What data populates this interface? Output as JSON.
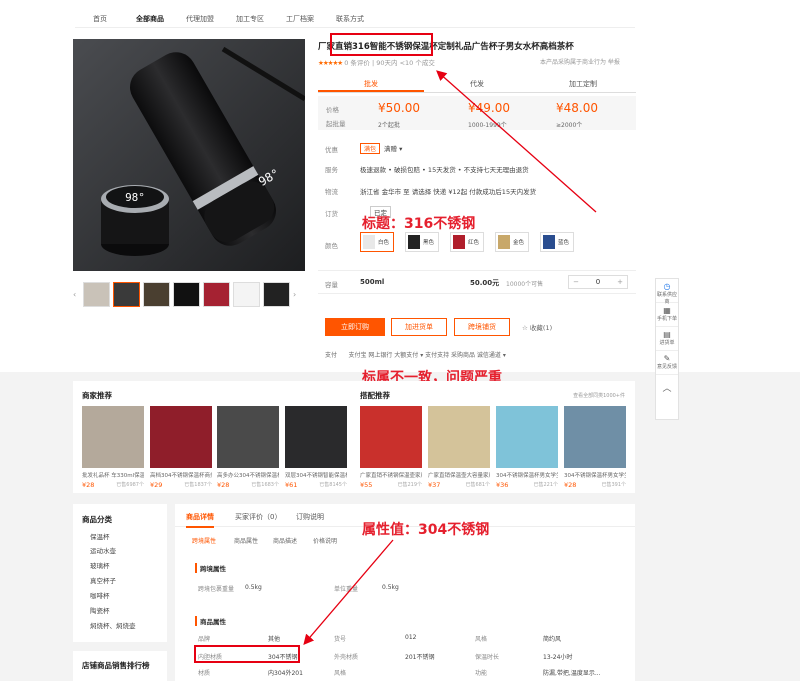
{
  "nav": [
    "首页",
    "全部商品",
    "代理加盟",
    "加工专区",
    "工厂档案",
    "联系方式"
  ],
  "product": {
    "title": "厂家直销316智能不锈钢保温杯定制礼品广告杯子男女水杯高档茶杯",
    "rating_text": "0 条评价 | 90天内 <10 个成交",
    "sub_right": "本产品采购属于商业行为  举报",
    "tabs": [
      "批发",
      "代发",
      "加工定制"
    ],
    "price_label": "价格",
    "qty_label": "起批量",
    "prices": [
      "¥50.00",
      "¥49.00",
      "¥48.00"
    ],
    "ranges": [
      "2个起批",
      "1000-1999个",
      "≥2000个"
    ],
    "promo_label": "优惠",
    "promo_tag": "满包",
    "promo_val": "满赠",
    "service_label": "服务",
    "service_val": "极速退款 • 破损包赔 • 15天发货 • 不支持七天无理由退货",
    "ship_label": "物流",
    "ship_val": "浙江省 金华市  至  请选择    快递  ¥12起      付款成功后15天内发货",
    "custom_label": "订货",
    "custom_val": "已定",
    "color_label": "颜色",
    "colors": [
      "白色",
      "黑色",
      "红色",
      "金色",
      "蓝色"
    ],
    "capacity_label": "容量",
    "capacity": "500ml",
    "capacity_price": "50.00元",
    "stock": "10000个可售",
    "qty": "0",
    "buttons": [
      "立即订购",
      "加进货单",
      "跨境铺货"
    ],
    "fav": "收藏(1)",
    "pay_label": "支付",
    "pay_items": "支付宝  网上银行  大额支付  ▾      支付支持  采购商品  诚信通道  ▾"
  },
  "annotations": {
    "title_note": "标题：316不锈钢",
    "mismatch_note": "标属不一致，问题严重",
    "attr_note": "属性值：304不锈钢"
  },
  "float_menu": [
    "联系供应商",
    "手机下单",
    "进货单",
    "意见反馈"
  ],
  "recommend": {
    "title": "商家推荐",
    "match_title": "搭配推荐",
    "more": "查看全部同类1000+件",
    "shop_items": [
      {
        "name": "批发礼品杯 车330ml保温杯",
        "price": "¥28",
        "sold": "已售6987个"
      },
      {
        "name": "高档304不锈钢保温杯商务",
        "price": "¥29",
        "sold": "已售1837个"
      },
      {
        "name": "高多办公304不锈钢保温杯",
        "price": "¥28",
        "sold": "已售1683个"
      },
      {
        "name": "双层304不锈钢智能保温杯",
        "price": "¥61",
        "sold": "已售8145个"
      }
    ],
    "match_items": [
      {
        "name": "广家直销不锈钢保温壶家用",
        "price": "¥55",
        "sold": "已售219个"
      },
      {
        "name": "广家直销保温壶大容量家用",
        "price": "¥37",
        "sold": "已售681个"
      },
      {
        "name": "304不锈钢保温杯男女学生",
        "price": "¥36",
        "sold": "已售221个"
      },
      {
        "name": "304不锈钢保温杯男女学生",
        "price": "¥28",
        "sold": "已售391个"
      }
    ]
  },
  "category": {
    "title": "商品分类",
    "items": [
      "保温杯",
      "运动水壶",
      "玻璃杯",
      "真空杯子",
      "咖啡杯",
      "陶瓷杯",
      "焖烧杯、焖烧壶"
    ]
  },
  "ranking_title": "店铺商品销售排行榜",
  "detail": {
    "tabs": [
      "商品详情",
      "买家评价（0）",
      "订购说明"
    ],
    "sub_tabs": [
      "跨境属性",
      "商品属性",
      "商品描述",
      "价格说明"
    ],
    "cross_title": "跨境属性",
    "cross_attrs": [
      {
        "k": "跨境包裹重量",
        "v": "0.5kg"
      },
      {
        "k": "单位重量",
        "v": "0.5kg"
      }
    ],
    "attr_title": "商品属性",
    "attrs_row1": [
      {
        "k": "品牌",
        "v": "其他"
      },
      {
        "k": "货号",
        "v": "012"
      },
      {
        "k": "风格",
        "v": "简约风"
      }
    ],
    "attrs_row2": [
      {
        "k": "内胆材质",
        "v": "304不锈钢"
      },
      {
        "k": "外壳材质",
        "v": "201不锈钢"
      },
      {
        "k": "保温时长",
        "v": "13-24小时"
      }
    ],
    "attrs_row3": [
      {
        "k": "材质",
        "v": "内304外201"
      },
      {
        "k": "风格",
        "v": ""
      },
      {
        "k": "功能",
        "v": "防漏,带把,温度显示..."
      }
    ]
  }
}
